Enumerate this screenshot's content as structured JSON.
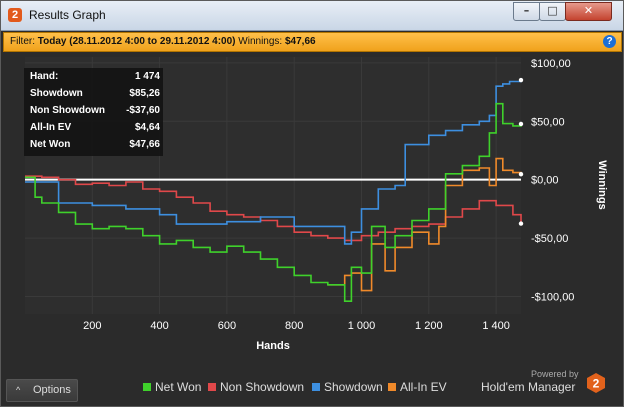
{
  "window": {
    "title": "Results Graph",
    "app_icon_glyph": "2",
    "buttons": {
      "minimize": "–",
      "maximize": "□",
      "close": "✕"
    }
  },
  "filter": {
    "label": "Filter:",
    "range": "Today (28.11.2012 4:00 to 29.11.2012 4:00)",
    "winnings_label": "Winnings:",
    "winnings_value": "$47,66",
    "help_glyph": "?"
  },
  "stats": [
    {
      "label": "Hand:",
      "value": "1 474"
    },
    {
      "label": "Showdown",
      "value": "$85,26"
    },
    {
      "label": "Non Showdown",
      "value": "-$37,60"
    },
    {
      "label": "All-In EV",
      "value": "$4,64"
    },
    {
      "label": "Net Won",
      "value": "$47,66"
    }
  ],
  "bottom": {
    "options_label": "Options",
    "options_caret": "^",
    "powered_by": "Powered by",
    "brand": "Hold'em Manager",
    "brand_logo_glyph": "2"
  },
  "colors": {
    "net_won": "#3fd12b",
    "non_showdown": "#e0484a",
    "showdown": "#3d8fe0",
    "allin_ev": "#f08a2a",
    "zero_line": "#ffffff",
    "grid": "#3a3a3a"
  },
  "chart_data": {
    "type": "line",
    "xlabel": "Hands",
    "ylabel": "Winnings",
    "xlim": [
      0,
      1474
    ],
    "ylim": [
      -115,
      105
    ],
    "x_ticks": [
      "200",
      "400",
      "600",
      "800",
      "1 000",
      "1 200",
      "1 400"
    ],
    "x_tick_values": [
      200,
      400,
      600,
      800,
      1000,
      1200,
      1400
    ],
    "y_ticks": [
      "$100,00",
      "$50,00",
      "$0,00",
      "-$50,00",
      "-$100,00"
    ],
    "y_tick_values": [
      100,
      50,
      0,
      -50,
      -100
    ],
    "legend": [
      "Net Won",
      "Non Showdown",
      "Showdown",
      "All-In EV"
    ],
    "legend_position": "bottom",
    "grid": true,
    "series": [
      {
        "name": "Net Won",
        "x": [
          0,
          30,
          50,
          100,
          150,
          200,
          250,
          300,
          350,
          400,
          450,
          500,
          550,
          600,
          650,
          700,
          750,
          800,
          850,
          900,
          950,
          970,
          1000,
          1030,
          1070,
          1100,
          1150,
          1200,
          1250,
          1300,
          1350,
          1380,
          1400,
          1420,
          1450,
          1474
        ],
        "y": [
          2,
          -15,
          -20,
          -28,
          -38,
          -42,
          -40,
          -42,
          -48,
          -55,
          -52,
          -58,
          -62,
          -57,
          -62,
          -68,
          -75,
          -82,
          -88,
          -90,
          -104,
          -75,
          -80,
          -40,
          -58,
          -48,
          -35,
          -25,
          5,
          12,
          20,
          40,
          65,
          48,
          46,
          47.66
        ]
      },
      {
        "name": "Non Showdown",
        "x": [
          0,
          50,
          100,
          150,
          200,
          250,
          300,
          350,
          400,
          450,
          500,
          550,
          600,
          650,
          700,
          750,
          800,
          850,
          900,
          950,
          1000,
          1050,
          1100,
          1150,
          1200,
          1250,
          1300,
          1350,
          1400,
          1450,
          1474
        ],
        "y": [
          3,
          2,
          0,
          -4,
          -3,
          -5,
          -2,
          -8,
          -10,
          -15,
          -20,
          -27,
          -30,
          -32,
          -35,
          -40,
          -45,
          -48,
          -50,
          -52,
          -48,
          -45,
          -42,
          -40,
          -38,
          -32,
          -25,
          -18,
          -22,
          -30,
          -37.6
        ]
      },
      {
        "name": "Showdown",
        "x": [
          0,
          100,
          200,
          300,
          400,
          450,
          500,
          600,
          700,
          800,
          900,
          950,
          970,
          1000,
          1050,
          1100,
          1130,
          1200,
          1250,
          1300,
          1350,
          1380,
          1400,
          1420,
          1440,
          1474
        ],
        "y": [
          -2,
          -20,
          -22,
          -25,
          -30,
          -38,
          -38,
          -36,
          -32,
          -40,
          -40,
          -55,
          -45,
          -25,
          -8,
          -5,
          30,
          38,
          42,
          47,
          50,
          55,
          80,
          82,
          84,
          85.26
        ]
      },
      {
        "name": "All-In EV",
        "x": [
          900,
          950,
          970,
          1000,
          1030,
          1070,
          1100,
          1150,
          1200,
          1230,
          1250,
          1300,
          1350,
          1380,
          1400,
          1420,
          1450,
          1474
        ],
        "y": [
          -90,
          -82,
          -80,
          -95,
          -55,
          -78,
          -58,
          -45,
          -55,
          -40,
          -5,
          8,
          10,
          -5,
          18,
          8,
          6,
          4.64
        ]
      }
    ],
    "zero_line": 0
  }
}
